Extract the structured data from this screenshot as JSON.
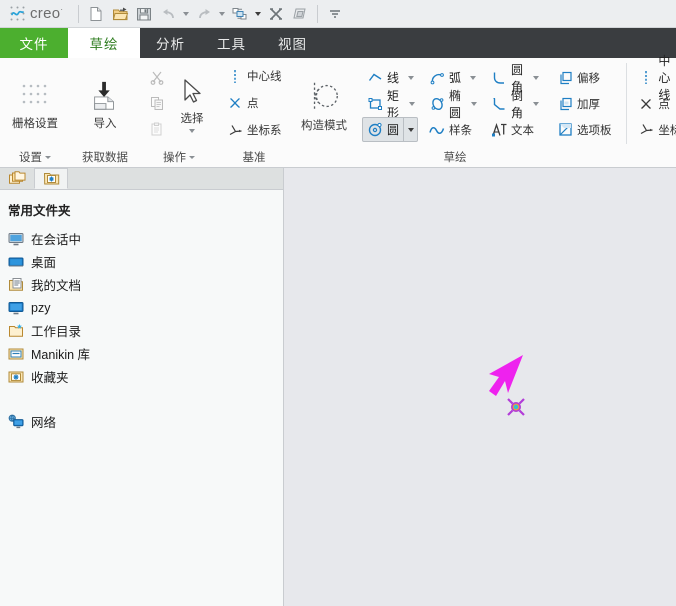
{
  "app": {
    "brand": "creo",
    "brand_sup": "·",
    "logo_icon": "creo-logo-icon"
  },
  "quick_access": {
    "buttons": [
      {
        "name": "new-file-button",
        "icon": "new-document-icon",
        "label": "新建"
      },
      {
        "name": "open-file-button",
        "icon": "open-folder-icon",
        "label": "打开"
      },
      {
        "name": "save-file-button",
        "icon": "save-disk-icon",
        "label": "保存"
      },
      {
        "name": "undo-button",
        "icon": "undo-arrow-icon",
        "label": "撤销"
      },
      {
        "name": "redo-button",
        "icon": "redo-arrow-icon",
        "label": "重做"
      },
      {
        "name": "regenerate-button",
        "icon": "regenerate-icon",
        "label": "重新生成"
      },
      {
        "name": "close-window-button",
        "icon": "close-x-icon",
        "label": "关闭窗口"
      },
      {
        "name": "switch-window-button",
        "icon": "switch-window-icon",
        "label": "切换窗口"
      },
      {
        "name": "customize-toolbar-button",
        "icon": "chevron-down-icon",
        "label": "自定义快速访问工具栏"
      }
    ]
  },
  "ribbon": {
    "tabs": [
      {
        "label": "文件",
        "state": "file"
      },
      {
        "label": "草绘",
        "state": "active"
      },
      {
        "label": "分析",
        "state": "normal"
      },
      {
        "label": "工具",
        "state": "normal"
      },
      {
        "label": "视图",
        "state": "normal"
      }
    ],
    "groups": [
      {
        "label": "设置",
        "has_dropdown": true,
        "items": [
          {
            "label": "栅格设置",
            "icon": "grid-settings-icon"
          }
        ]
      },
      {
        "label": "获取数据",
        "has_dropdown": false,
        "items": [
          {
            "label": "导入",
            "icon": "import-icon"
          }
        ]
      },
      {
        "label": "操作",
        "has_dropdown": true,
        "items": [
          {
            "label": "剪切",
            "icon": "scissors-icon"
          },
          {
            "label": "复制",
            "icon": "copy-icon"
          },
          {
            "label": "粘贴",
            "icon": "paste-icon"
          },
          {
            "label": "选择",
            "icon": "arrow-cursor-icon"
          }
        ]
      },
      {
        "label": "基准",
        "has_dropdown": false,
        "items": [
          {
            "label": "中心线",
            "icon": "centerline-icon"
          },
          {
            "label": "点",
            "icon": "point-icon"
          },
          {
            "label": "坐标系",
            "icon": "coordinate-system-icon"
          }
        ]
      },
      {
        "label": "",
        "has_dropdown": false,
        "items": [
          {
            "label": "构造模式",
            "icon": "construction-mode-icon"
          }
        ]
      },
      {
        "label": "草绘",
        "has_dropdown": false,
        "items": [
          {
            "label": "线",
            "icon": "line-icon"
          },
          {
            "label": "矩形",
            "icon": "rectangle-icon"
          },
          {
            "label": "圆",
            "icon": "circle-icon"
          },
          {
            "label": "弧",
            "icon": "arc-icon"
          },
          {
            "label": "椭圆",
            "icon": "ellipse-icon"
          },
          {
            "label": "样条",
            "icon": "spline-icon"
          },
          {
            "label": "圆角",
            "icon": "fillet-icon"
          },
          {
            "label": "倒角",
            "icon": "chamfer-icon"
          },
          {
            "label": "文本",
            "icon": "text-icon"
          },
          {
            "label": "偏移",
            "icon": "offset-icon"
          },
          {
            "label": "加厚",
            "icon": "thicken-icon"
          },
          {
            "label": "选项板",
            "icon": "palette-icon"
          },
          {
            "label": "中心线",
            "icon": "centerline-icon"
          },
          {
            "label": "点",
            "icon": "point-icon"
          },
          {
            "label": "坐标系",
            "icon": "coordinate-system-icon"
          }
        ]
      }
    ],
    "selected_tool": "圆"
  },
  "sidebar": {
    "tabs": [
      {
        "name": "navigator-tab",
        "icon": "folder-stack-icon",
        "active": false
      },
      {
        "name": "favorites-tab",
        "icon": "favorites-folder-icon",
        "active": true
      }
    ],
    "heading": "常用文件夹",
    "items": [
      {
        "label": "在会话中",
        "icon": "in-session-monitor-icon"
      },
      {
        "label": "桌面",
        "icon": "desktop-icon"
      },
      {
        "label": "我的文档",
        "icon": "my-documents-icon"
      },
      {
        "label": "pzy",
        "icon": "computer-icon"
      },
      {
        "label": "工作目录",
        "icon": "working-directory-icon"
      },
      {
        "label": "Manikin 库",
        "icon": "manikin-library-icon"
      },
      {
        "label": "收藏夹",
        "icon": "favorites-folder-icon"
      }
    ],
    "network": {
      "label": "网络",
      "icon": "network-icon"
    }
  },
  "canvas": {
    "background_color": "#e7e8ec",
    "annotation_arrow": {
      "name": "annotation-arrow",
      "color": "#e81fe8"
    },
    "sketch_cursor": {
      "name": "circle-tool-cursor",
      "tool": "圆"
    }
  },
  "colors": {
    "tab_bar": "#3a3d40",
    "file_tab_green": "#4caf2f",
    "active_tab_text": "#2f7d20",
    "icon_blue": "#1f7fc4",
    "accent_magenta": "#e81fe8"
  }
}
